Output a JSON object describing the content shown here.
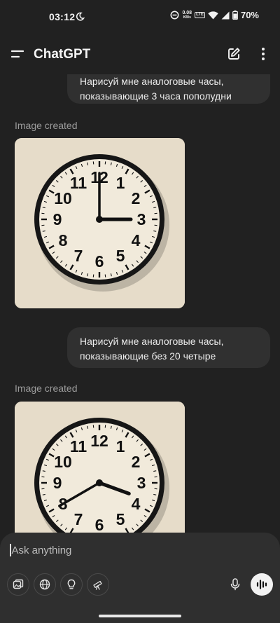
{
  "status_bar": {
    "time": "03:12",
    "net_speed_value": "0.08",
    "net_speed_unit": "KB/s",
    "network_type": "LTE",
    "battery": "70%"
  },
  "header": {
    "title": "ChatGPT",
    "icons": [
      "menu-icon",
      "edit-icon",
      "more-icon"
    ]
  },
  "messages": [
    {
      "role": "user",
      "text": "Нарисуй мне аналоговые часы, показывающие 3 часа пополудни"
    },
    {
      "role": "assistant",
      "label": "Image created",
      "image": "analog-clock-3-00"
    },
    {
      "role": "user",
      "text": "Нарисуй мне аналоговые часы, показывающие без 20 четыре"
    },
    {
      "role": "assistant",
      "label": "Image created",
      "image": "analog-clock-3-40"
    }
  ],
  "clock_numerals": [
    "12",
    "1",
    "2",
    "3",
    "4",
    "5",
    "6",
    "7",
    "8",
    "9",
    "10",
    "11"
  ],
  "composer": {
    "placeholder": "Ask anything",
    "tools": [
      "image-icon",
      "globe-icon",
      "lightbulb-icon",
      "telescope-icon",
      "mic-icon",
      "voice-mode-icon"
    ]
  },
  "colors": {
    "background": "#212121",
    "bubble": "#303030",
    "composer": "#2f2f2f",
    "clock_wall": "#e6dcc9",
    "clock_face": "#f1eadb",
    "clock_frame": "#161616"
  }
}
